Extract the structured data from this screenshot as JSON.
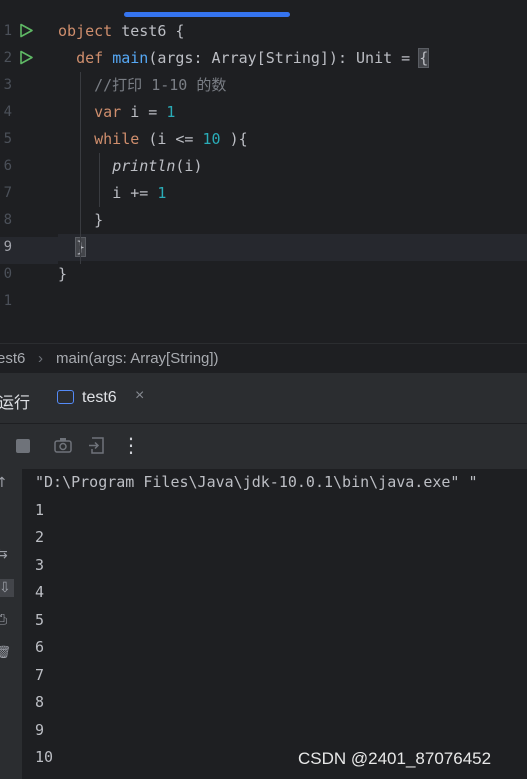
{
  "editor": {
    "line_numbers": [
      "1",
      "2",
      "3",
      "4",
      "5",
      "6",
      "7",
      "8",
      "9",
      "0",
      "1"
    ],
    "lines": [
      [
        {
          "t": "object ",
          "c": "kw"
        },
        {
          "t": "test6 {",
          "c": ""
        }
      ],
      [
        {
          "t": "  ",
          "c": ""
        },
        {
          "t": "def ",
          "c": "kw"
        },
        {
          "t": "main",
          "c": "fn"
        },
        {
          "t": "(args: Array[String]): Unit = ",
          "c": ""
        },
        {
          "t": "{",
          "c": "brace-match"
        }
      ],
      [
        {
          "t": "    ",
          "c": ""
        },
        {
          "t": "//打印 1-10 的数",
          "c": "cmt"
        }
      ],
      [
        {
          "t": "    ",
          "c": ""
        },
        {
          "t": "var ",
          "c": "kw"
        },
        {
          "t": "i = ",
          "c": ""
        },
        {
          "t": "1",
          "c": "num"
        }
      ],
      [
        {
          "t": "    ",
          "c": ""
        },
        {
          "t": "while ",
          "c": "kw"
        },
        {
          "t": "(i <= ",
          "c": ""
        },
        {
          "t": "10",
          "c": "num"
        },
        {
          "t": " ){",
          "c": ""
        }
      ],
      [
        {
          "t": "      ",
          "c": ""
        },
        {
          "t": "println",
          "c": "ital"
        },
        {
          "t": "(i)",
          "c": ""
        }
      ],
      [
        {
          "t": "      ",
          "c": ""
        },
        {
          "t": "i += ",
          "c": ""
        },
        {
          "t": "1",
          "c": "num"
        }
      ],
      [
        {
          "t": "    }",
          "c": ""
        }
      ],
      [
        {
          "t": "  ",
          "c": ""
        },
        {
          "t": "}",
          "c": "brace-match"
        }
      ],
      [
        {
          "t": "}",
          "c": ""
        }
      ],
      [
        {
          "t": "",
          "c": ""
        }
      ]
    ],
    "current_line_index": 8
  },
  "breadcrumb": {
    "items": [
      "est6",
      "main(args: Array[String])"
    ],
    "separator": "›"
  },
  "run_window": {
    "title": "运行",
    "tab_label": "test6",
    "tab_close": "×",
    "toolbar_icons": [
      "stop-icon",
      "camera-icon",
      "exit-icon",
      "more-vertical-icon"
    ],
    "more_glyph": "⋮"
  },
  "console": {
    "lines": [
      "\"D:\\Program Files\\Java\\jdk-10.0.1\\bin\\java.exe\" \"",
      "1",
      "2",
      "3",
      "4",
      "5",
      "6",
      "7",
      "8",
      "9",
      "10"
    ],
    "side_glyphs": [
      "↑",
      "⇆",
      "⇩",
      "⎙",
      "🗑"
    ]
  },
  "watermark": "CSDN @2401_87076452",
  "colors": {
    "background": "#1e1f22",
    "panel": "#2b2d30",
    "keyword": "#cf8e6d",
    "function": "#56a8f5",
    "number": "#2aacb8",
    "comment": "#7a7e85",
    "run_icon": "#5fb865",
    "accent": "#3574f0"
  }
}
